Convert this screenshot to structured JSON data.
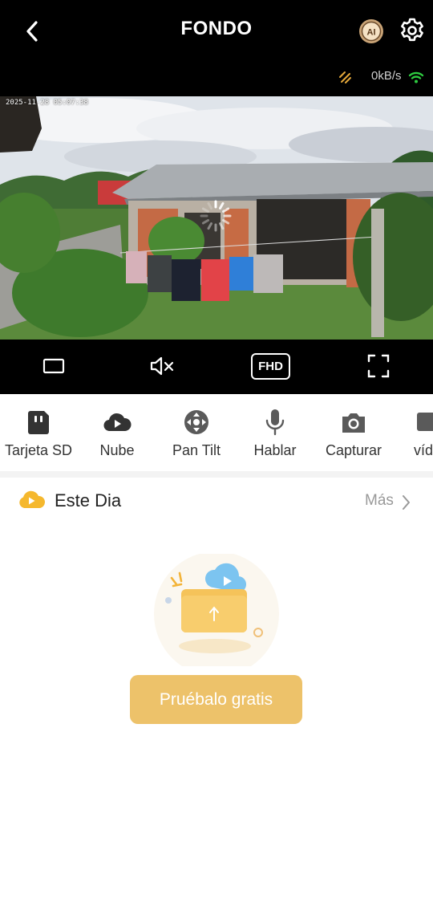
{
  "header": {
    "title": "FONDO",
    "ai_badge": "AI",
    "bitrate": "0kB/s",
    "wifi_color": "#2ecc40",
    "speed_icon_color": "#e6a93a"
  },
  "video": {
    "osd_timestamp": "2025-11-28 05:07:38"
  },
  "video_controls": {
    "fhd_label": "FHD"
  },
  "toolbar": {
    "items": [
      {
        "label": "Tarjeta SD",
        "icon": "sd-card-icon"
      },
      {
        "label": "Nube",
        "icon": "cloud-play-icon"
      },
      {
        "label": "Pan Tilt",
        "icon": "pan-tilt-icon"
      },
      {
        "label": "Hablar",
        "icon": "microphone-icon"
      },
      {
        "label": "Capturar",
        "icon": "camera-icon"
      },
      {
        "label": "víd",
        "icon": "video-icon"
      }
    ]
  },
  "section": {
    "title": "Este Dia",
    "more_label": "Más",
    "icon_color": "#f5b82e"
  },
  "empty_state": {
    "cta_label": "Pruébalo gratis",
    "cta_color": "#edc26a"
  }
}
